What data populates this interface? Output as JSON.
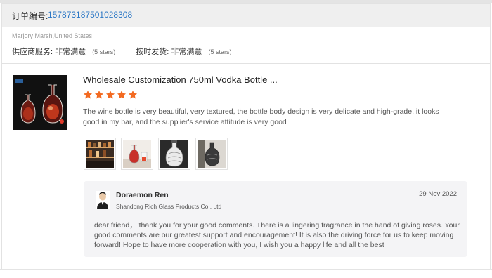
{
  "order": {
    "label": "订单编号:",
    "number": "157873187501028308"
  },
  "buyer": {
    "name_location": "Marjory Marsh,United States",
    "ratings": [
      {
        "label": "供应商服务:",
        "value": "非常满意",
        "stars": "(5 stars)"
      },
      {
        "label": "按时发货:",
        "value": "非常满意",
        "stars": "(5 stars)"
      }
    ]
  },
  "review": {
    "product_title": "Wholesale Customization 750ml Vodka Bottle ...",
    "star_count": 5,
    "star_color": "#f36a21",
    "text": "The wine bottle is very beautiful, very textured, the bottle body design is very delicate and high-grade, it looks good in my bar, and the supplier's service attitude is very good",
    "photos": [
      "bar-shelf-photo",
      "bottle-on-table-photo",
      "bottle-closeup-photo",
      "bottle-detail-photo"
    ]
  },
  "reply": {
    "supplier_name": "Doraemon Ren",
    "company": "Shandong Rich Glass Products Co., Ltd",
    "date": "29 Nov 2022",
    "text": "dear friend， thank you for your good comments. There is a lingering fragrance in the hand of giving roses. Your good comments are our greatest support and encouragement! It is also the driving force for us to keep moving forward! Hope to have more cooperation with you, I wish you a happy life and all the best"
  },
  "colors": {
    "accent_link": "#2b77c5",
    "star": "#f36a21",
    "reply_bg": "#f4f4f6"
  }
}
